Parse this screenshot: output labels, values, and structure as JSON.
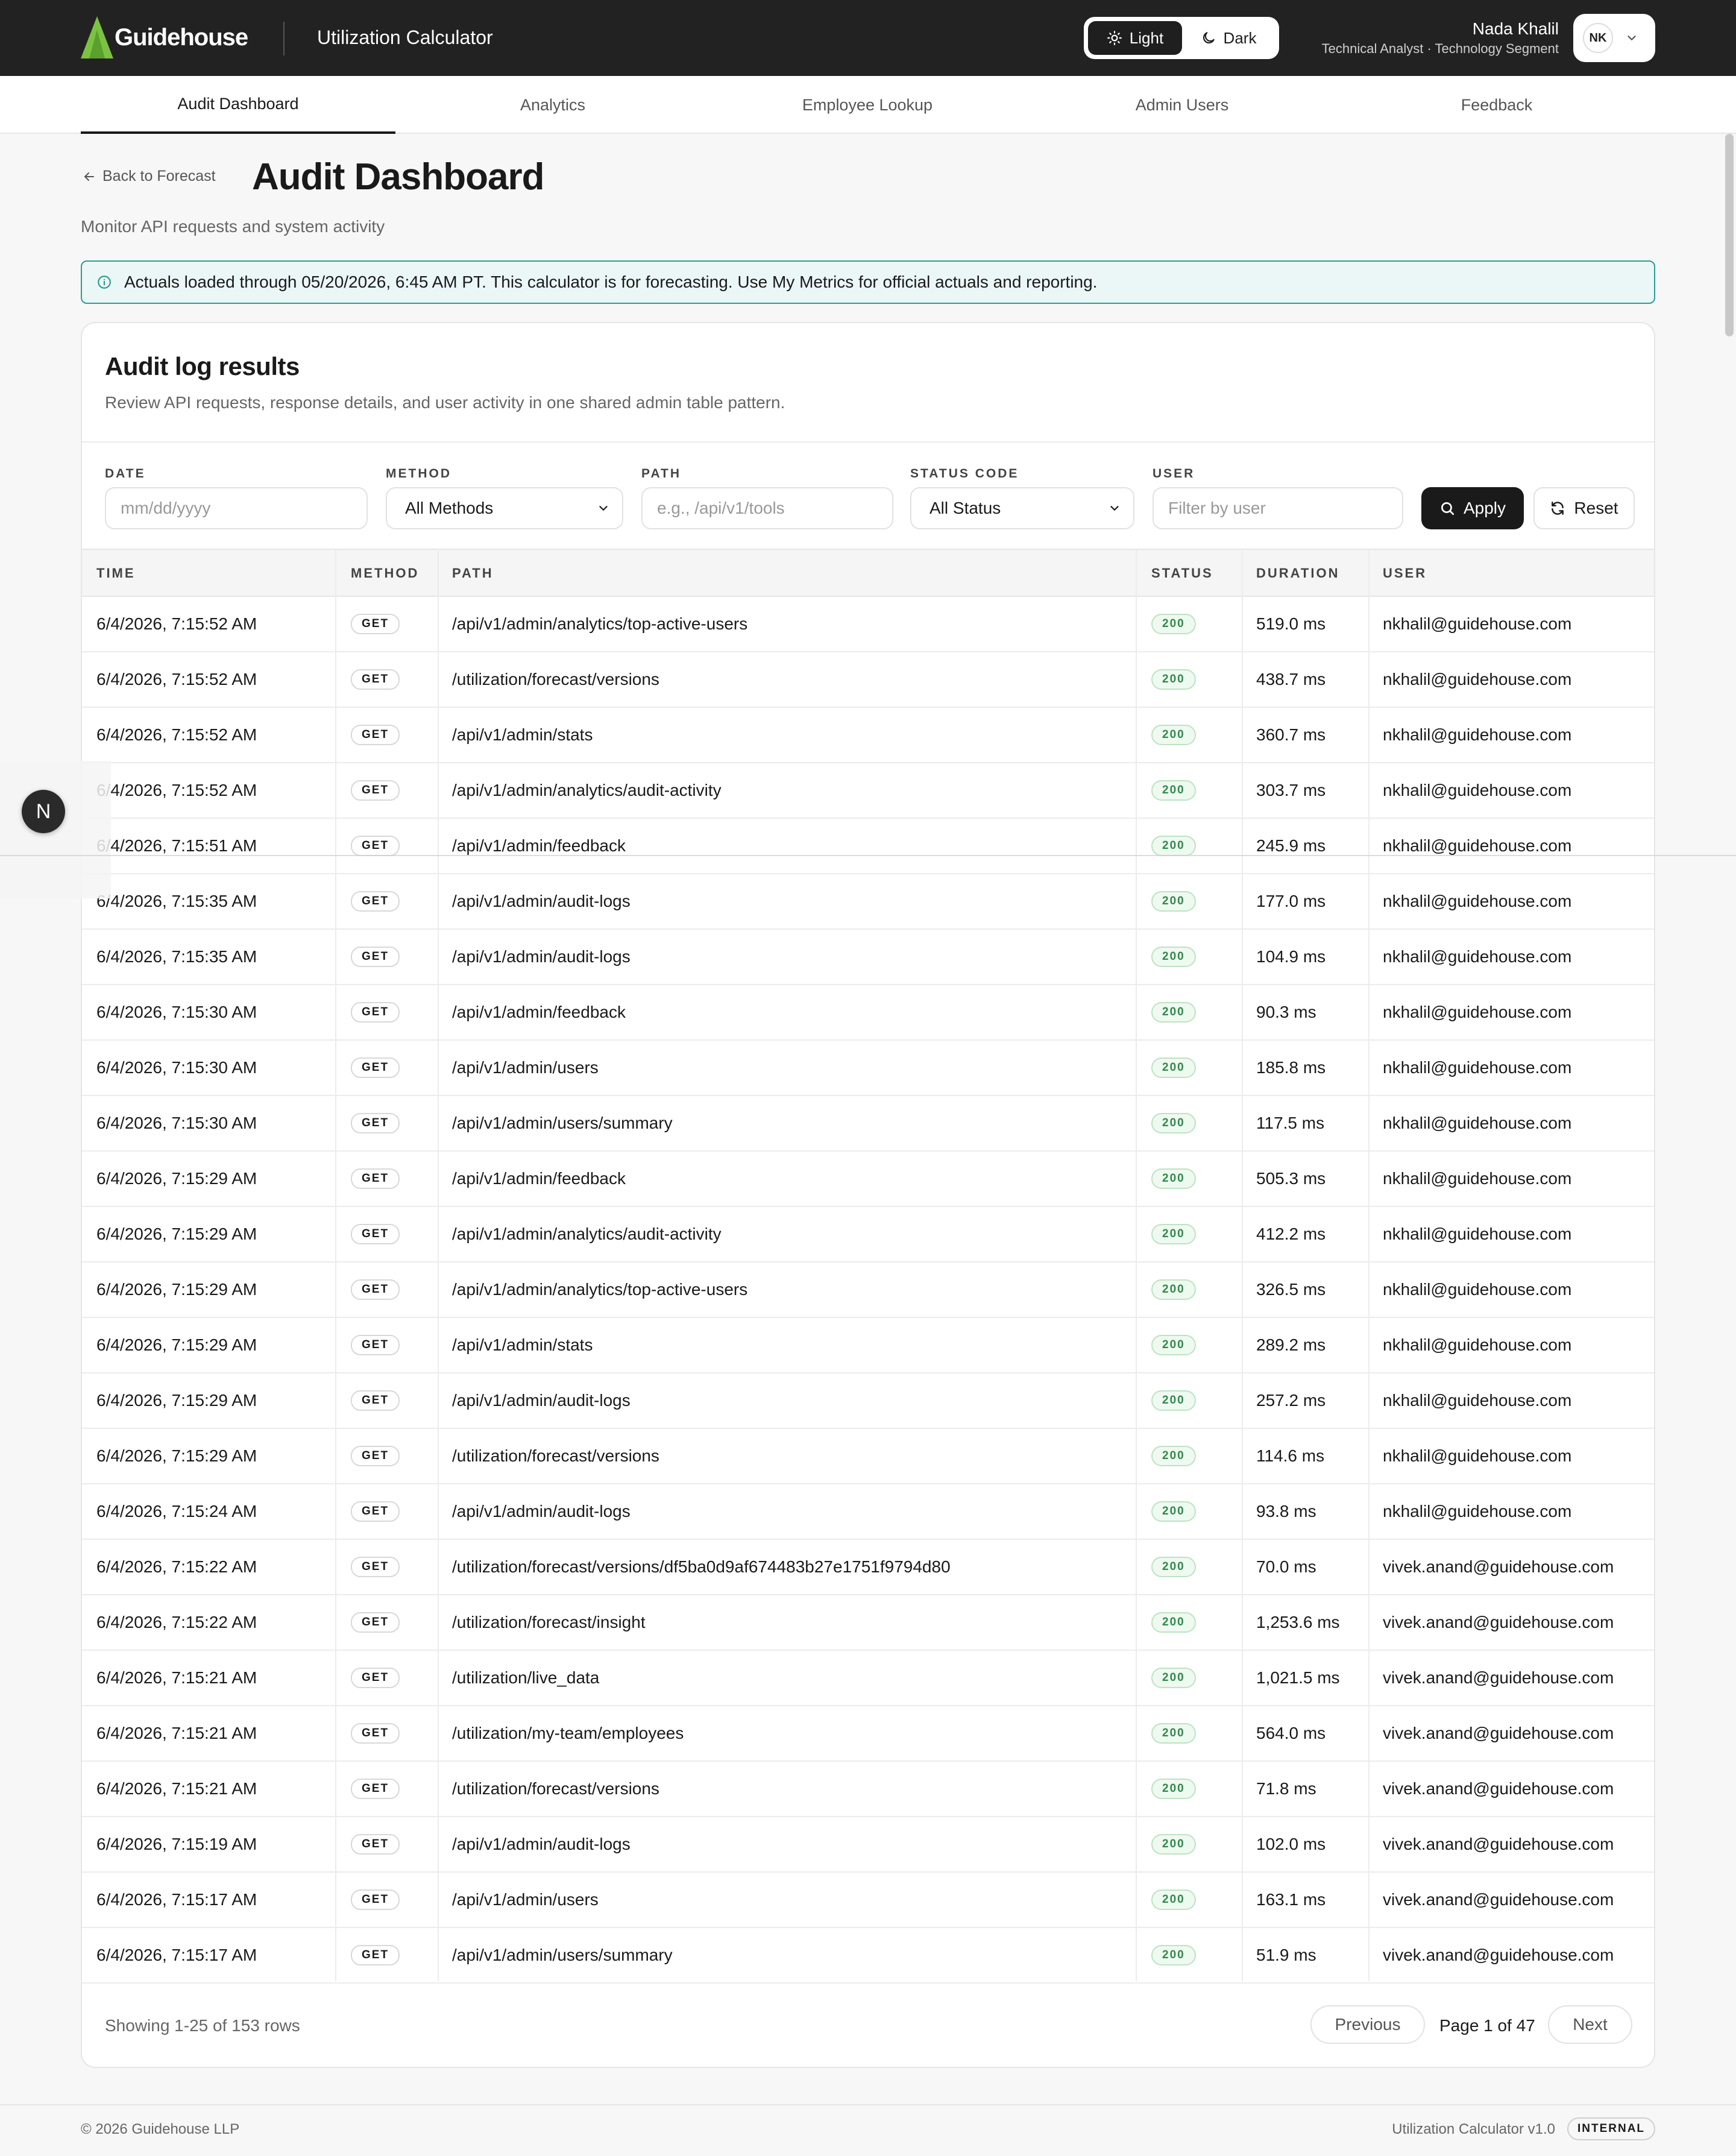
{
  "header": {
    "brand": "Guidehouse",
    "app_title": "Utilization Calculator",
    "theme": {
      "light_label": "Light",
      "dark_label": "Dark",
      "selected": "Light"
    },
    "user": {
      "name": "Nada Khalil",
      "role": "Technical Analyst · Technology Segment",
      "initials": "NK"
    }
  },
  "tabs": [
    {
      "label": "Audit Dashboard",
      "active": true
    },
    {
      "label": "Analytics",
      "active": false
    },
    {
      "label": "Employee Lookup",
      "active": false
    },
    {
      "label": "Admin Users",
      "active": false
    },
    {
      "label": "Feedback",
      "active": false
    }
  ],
  "page": {
    "back_label": "Back to Forecast",
    "title": "Audit Dashboard",
    "subtitle": "Monitor API requests and system activity",
    "notice": "Actuals loaded through 05/20/2026, 6:45 AM PT. This calculator is for forecasting. Use My Metrics for official actuals and reporting."
  },
  "card": {
    "title": "Audit log results",
    "description": "Review API requests, response details, and user activity in one shared admin table pattern."
  },
  "filters": {
    "date": {
      "label": "DATE",
      "placeholder": "mm/dd/yyyy"
    },
    "method": {
      "label": "METHOD",
      "value": "All Methods"
    },
    "path": {
      "label": "PATH",
      "placeholder": "e.g., /api/v1/tools"
    },
    "status": {
      "label": "STATUS CODE",
      "value": "All Status"
    },
    "user": {
      "label": "USER",
      "placeholder": "Filter by user"
    },
    "apply_label": "Apply",
    "reset_label": "Reset"
  },
  "table": {
    "columns": [
      "TIME",
      "METHOD",
      "PATH",
      "STATUS",
      "DURATION",
      "USER"
    ],
    "rows": [
      {
        "time": "6/4/2026, 7:15:52 AM",
        "method": "GET",
        "path": "/api/v1/admin/analytics/top-active-users",
        "status": "200",
        "duration": "519.0 ms",
        "user": "nkhalil@guidehouse.com"
      },
      {
        "time": "6/4/2026, 7:15:52 AM",
        "method": "GET",
        "path": "/utilization/forecast/versions",
        "status": "200",
        "duration": "438.7 ms",
        "user": "nkhalil@guidehouse.com"
      },
      {
        "time": "6/4/2026, 7:15:52 AM",
        "method": "GET",
        "path": "/api/v1/admin/stats",
        "status": "200",
        "duration": "360.7 ms",
        "user": "nkhalil@guidehouse.com"
      },
      {
        "time": "6/4/2026, 7:15:52 AM",
        "method": "GET",
        "path": "/api/v1/admin/analytics/audit-activity",
        "status": "200",
        "duration": "303.7 ms",
        "user": "nkhalil@guidehouse.com"
      },
      {
        "time": "6/4/2026, 7:15:51 AM",
        "method": "GET",
        "path": "/api/v1/admin/feedback",
        "status": "200",
        "duration": "245.9 ms",
        "user": "nkhalil@guidehouse.com"
      },
      {
        "time": "6/4/2026, 7:15:35 AM",
        "method": "GET",
        "path": "/api/v1/admin/audit-logs",
        "status": "200",
        "duration": "177.0 ms",
        "user": "nkhalil@guidehouse.com"
      },
      {
        "time": "6/4/2026, 7:15:35 AM",
        "method": "GET",
        "path": "/api/v1/admin/audit-logs",
        "status": "200",
        "duration": "104.9 ms",
        "user": "nkhalil@guidehouse.com"
      },
      {
        "time": "6/4/2026, 7:15:30 AM",
        "method": "GET",
        "path": "/api/v1/admin/feedback",
        "status": "200",
        "duration": "90.3 ms",
        "user": "nkhalil@guidehouse.com"
      },
      {
        "time": "6/4/2026, 7:15:30 AM",
        "method": "GET",
        "path": "/api/v1/admin/users",
        "status": "200",
        "duration": "185.8 ms",
        "user": "nkhalil@guidehouse.com"
      },
      {
        "time": "6/4/2026, 7:15:30 AM",
        "method": "GET",
        "path": "/api/v1/admin/users/summary",
        "status": "200",
        "duration": "117.5 ms",
        "user": "nkhalil@guidehouse.com"
      },
      {
        "time": "6/4/2026, 7:15:29 AM",
        "method": "GET",
        "path": "/api/v1/admin/feedback",
        "status": "200",
        "duration": "505.3 ms",
        "user": "nkhalil@guidehouse.com"
      },
      {
        "time": "6/4/2026, 7:15:29 AM",
        "method": "GET",
        "path": "/api/v1/admin/analytics/audit-activity",
        "status": "200",
        "duration": "412.2 ms",
        "user": "nkhalil@guidehouse.com"
      },
      {
        "time": "6/4/2026, 7:15:29 AM",
        "method": "GET",
        "path": "/api/v1/admin/analytics/top-active-users",
        "status": "200",
        "duration": "326.5 ms",
        "user": "nkhalil@guidehouse.com"
      },
      {
        "time": "6/4/2026, 7:15:29 AM",
        "method": "GET",
        "path": "/api/v1/admin/stats",
        "status": "200",
        "duration": "289.2 ms",
        "user": "nkhalil@guidehouse.com"
      },
      {
        "time": "6/4/2026, 7:15:29 AM",
        "method": "GET",
        "path": "/api/v1/admin/audit-logs",
        "status": "200",
        "duration": "257.2 ms",
        "user": "nkhalil@guidehouse.com"
      },
      {
        "time": "6/4/2026, 7:15:29 AM",
        "method": "GET",
        "path": "/utilization/forecast/versions",
        "status": "200",
        "duration": "114.6 ms",
        "user": "nkhalil@guidehouse.com"
      },
      {
        "time": "6/4/2026, 7:15:24 AM",
        "method": "GET",
        "path": "/api/v1/admin/audit-logs",
        "status": "200",
        "duration": "93.8 ms",
        "user": "nkhalil@guidehouse.com"
      },
      {
        "time": "6/4/2026, 7:15:22 AM",
        "method": "GET",
        "path": "/utilization/forecast/versions/df5ba0d9af674483b27e1751f9794d80",
        "status": "200",
        "duration": "70.0 ms",
        "user": "vivek.anand@guidehouse.com"
      },
      {
        "time": "6/4/2026, 7:15:22 AM",
        "method": "GET",
        "path": "/utilization/forecast/insight",
        "status": "200",
        "duration": "1,253.6 ms",
        "user": "vivek.anand@guidehouse.com"
      },
      {
        "time": "6/4/2026, 7:15:21 AM",
        "method": "GET",
        "path": "/utilization/live_data",
        "status": "200",
        "duration": "1,021.5 ms",
        "user": "vivek.anand@guidehouse.com"
      },
      {
        "time": "6/4/2026, 7:15:21 AM",
        "method": "GET",
        "path": "/utilization/my-team/employees",
        "status": "200",
        "duration": "564.0 ms",
        "user": "vivek.anand@guidehouse.com"
      },
      {
        "time": "6/4/2026, 7:15:21 AM",
        "method": "GET",
        "path": "/utilization/forecast/versions",
        "status": "200",
        "duration": "71.8 ms",
        "user": "vivek.anand@guidehouse.com"
      },
      {
        "time": "6/4/2026, 7:15:19 AM",
        "method": "GET",
        "path": "/api/v1/admin/audit-logs",
        "status": "200",
        "duration": "102.0 ms",
        "user": "vivek.anand@guidehouse.com"
      },
      {
        "time": "6/4/2026, 7:15:17 AM",
        "method": "GET",
        "path": "/api/v1/admin/users",
        "status": "200",
        "duration": "163.1 ms",
        "user": "vivek.anand@guidehouse.com"
      },
      {
        "time": "6/4/2026, 7:15:17 AM",
        "method": "GET",
        "path": "/api/v1/admin/users/summary",
        "status": "200",
        "duration": "51.9 ms",
        "user": "vivek.anand@guidehouse.com"
      }
    ]
  },
  "pagination": {
    "summary": "Showing 1-25 of 153 rows",
    "previous_label": "Previous",
    "page_label": "Page 1 of 47",
    "next_label": "Next"
  },
  "footer": {
    "copyright": "© 2026 Guidehouse LLP",
    "version": "Utilization Calculator v1.0",
    "badge": "INTERNAL"
  },
  "floating": {
    "button_label": "N"
  },
  "colors": {
    "header_bg": "#222222",
    "brand_green": "#7cc242",
    "notice_border": "#2a9d90",
    "status_green": "#2f8a4a"
  }
}
